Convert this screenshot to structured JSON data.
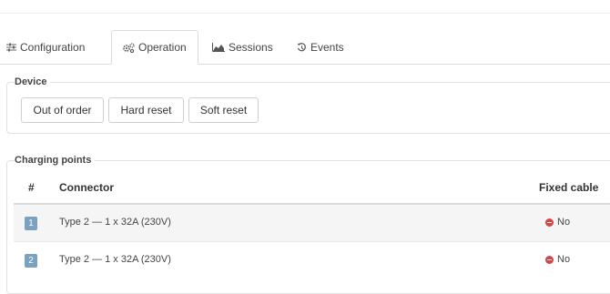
{
  "tabs": [
    {
      "label": "Configuration",
      "icon": "sliders-icon",
      "active": false
    },
    {
      "label": "Operation",
      "icon": "cogs-icon",
      "active": true
    },
    {
      "label": "Sessions",
      "icon": "area-chart-icon",
      "active": false
    },
    {
      "label": "Events",
      "icon": "history-icon",
      "active": false
    }
  ],
  "device": {
    "legend": "Device",
    "buttons": [
      "Out of order",
      "Hard reset",
      "Soft reset"
    ]
  },
  "charging_points": {
    "legend": "Charging points",
    "columns": [
      "#",
      "Connector",
      "Fixed cable"
    ],
    "rows": [
      {
        "num": "1",
        "connector": "Type 2 — 1 x 32A (230V)",
        "fixed_cable": "No"
      },
      {
        "num": "2",
        "connector": "Type 2 — 1 x 32A (230V)",
        "fixed_cable": "No"
      }
    ]
  },
  "colors": {
    "badge": "#7aa1c2",
    "status_no": "#d64545"
  }
}
